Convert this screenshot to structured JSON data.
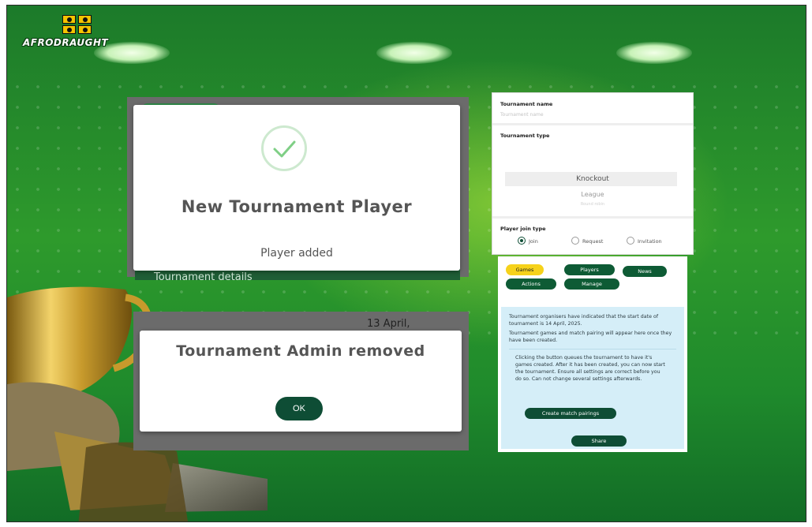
{
  "brand": {
    "logo_text": "AFRODRAUGHT"
  },
  "modal_player": {
    "title": "New Tournament Player",
    "message": "Player added",
    "behind_label": "Tournament details"
  },
  "modal_admin": {
    "title": "Tournament Admin removed",
    "ok_label": "OK",
    "behind_date": "13 April,"
  },
  "form": {
    "name_label": "Tournament name",
    "name_placeholder": "Tournament name",
    "type_label": "Tournament type",
    "type_options": [
      "Knockout",
      "League",
      "Round robin"
    ],
    "join_label": "Player join type",
    "join_options": [
      {
        "label": "Join",
        "selected": true
      },
      {
        "label": "Request",
        "selected": false
      },
      {
        "label": "Invitation",
        "selected": false
      }
    ]
  },
  "tabs": [
    {
      "label": "Games",
      "active": true
    },
    {
      "label": "Players",
      "active": false
    },
    {
      "label": "News",
      "active": false
    },
    {
      "label": "Actions",
      "active": false
    },
    {
      "label": "Manage",
      "active": false
    }
  ],
  "info": {
    "p1": "Tournament organisers have indicated that the start date of tournament is 14 April, 2025.",
    "p2": "Tournament games and match pairing will appear here once they have been created.",
    "p3": "Clicking the button queues the tournament to have it's games created. After it has been created, you can now start the tournament. Ensure all settings are correct before you do so. Can not change several settings afterwards.",
    "create_label": "Create match pairings",
    "share_label": "Share"
  },
  "colors": {
    "accent_dark_green": "#0e4d35",
    "tab_active_yellow": "#f6d21b",
    "background_green": "#2e9a2c",
    "info_blue": "#d5eef8"
  }
}
